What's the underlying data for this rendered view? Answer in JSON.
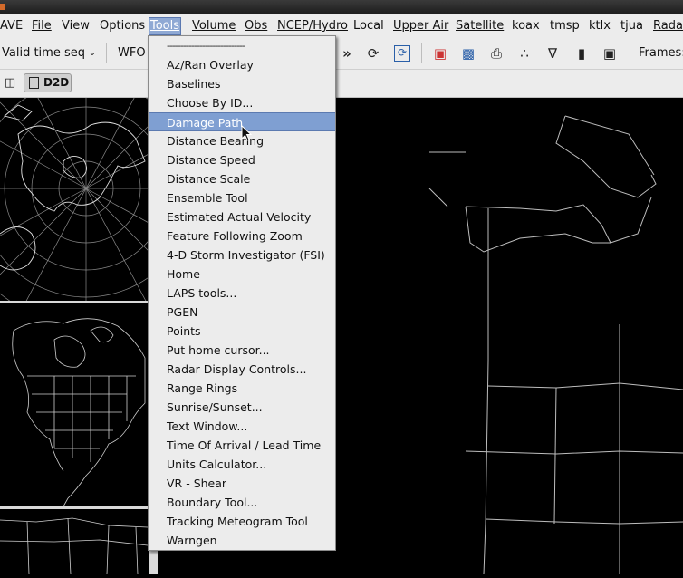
{
  "menubar": {
    "items": [
      "AVE",
      "File",
      "View",
      "Options",
      "Tools",
      "Volume",
      "Obs",
      "NCEP/Hydro",
      "Local",
      "Upper Air",
      "Satellite",
      "koax",
      "tmsp",
      "ktlx",
      "tjua",
      "Radar"
    ]
  },
  "toolbar": {
    "time_seq": "Valid time seq",
    "wfo": "WFO",
    "frames_label": "Frames:"
  },
  "toolbar2": {
    "d2d_label": "D2D"
  },
  "tools_menu": {
    "separator": "-----------------------------",
    "items": [
      "Az/Ran Overlay",
      "Baselines",
      "Choose By ID...",
      "Damage Path",
      "Distance Bearing",
      "Distance Speed",
      "Distance Scale",
      "Ensemble Tool",
      "Estimated Actual Velocity",
      "Feature Following Zoom",
      "4-D Storm Investigator (FSI)",
      "Home",
      "LAPS tools...",
      "PGEN",
      "Points",
      "Put home cursor...",
      "Radar Display Controls...",
      "Range Rings",
      "Sunrise/Sunset...",
      "Text Window...",
      "Time Of Arrival / Lead Time",
      "Units Calculator...",
      "VR - Shear",
      "Boundary Tool...",
      "Tracking Meteogram Tool",
      "Warngen"
    ],
    "highlighted": "Damage Path"
  },
  "icons": {
    "dropdown_arrow": "chevron-down-icon",
    "skip_forward": "skip-forward-icon",
    "loop": "loop-icon",
    "refresh": "refresh-icon",
    "print": "print-icon",
    "points": "points-icon",
    "sample": "sample-icon"
  },
  "colors": {
    "menu_bg": "#ececec",
    "highlight": "#7f9fd2",
    "map_bg": "#000000",
    "map_lines": "#bfbfbf"
  }
}
